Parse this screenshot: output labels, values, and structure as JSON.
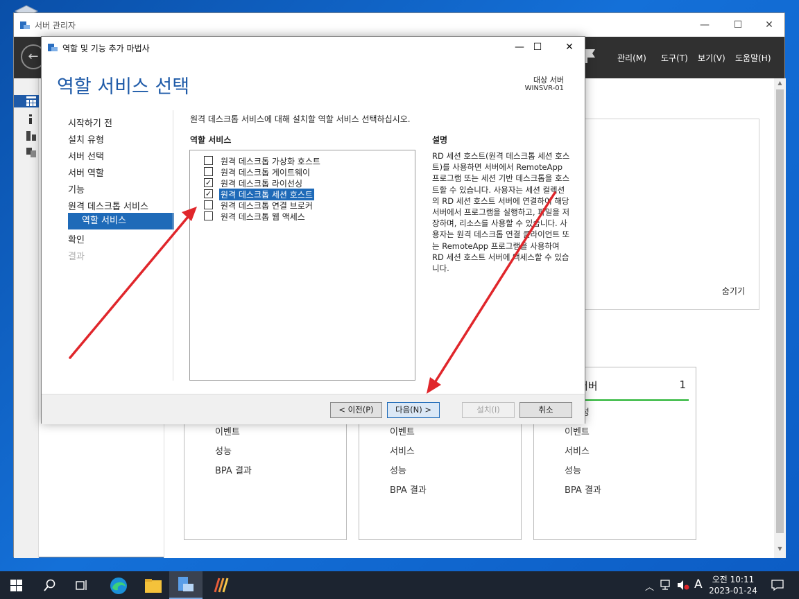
{
  "server_manager": {
    "title": "서버 관리자",
    "menu": [
      "관리(M)",
      "도구(T)",
      "보기(V)",
      "도움말(H)"
    ],
    "welcome_hide": "숨기기",
    "tiles": [
      {
        "header": "",
        "count": "",
        "rows": [
          "이벤트",
          "성능",
          "BPA 결과"
        ]
      },
      {
        "header": "",
        "count": "",
        "rows": [
          "이벤트",
          "서비스",
          "성능",
          "BPA 결과"
        ]
      },
      {
        "header": "서버",
        "count": "1",
        "rows": [
          "효율성",
          "이벤트",
          "서비스",
          "성능",
          "BPA 결과"
        ]
      }
    ]
  },
  "wizard": {
    "title": "역할 및 기능 추가 마법사",
    "page_title": "역할 서비스 선택",
    "destination_label": "대상 서버",
    "destination_server": "WINSVR-01",
    "nav": [
      {
        "label": "시작하기 전",
        "state": "normal"
      },
      {
        "label": "설치 유형",
        "state": "normal"
      },
      {
        "label": "서버 선택",
        "state": "normal"
      },
      {
        "label": "서버 역할",
        "state": "normal"
      },
      {
        "label": "기능",
        "state": "normal"
      },
      {
        "label": "원격 데스크톱 서비스",
        "state": "normal"
      },
      {
        "label": "역할 서비스",
        "state": "selected"
      },
      {
        "label": "확인",
        "state": "normal"
      },
      {
        "label": "결과",
        "state": "disabled"
      }
    ],
    "instruction": "원격 데스크톱 서비스에 대해 설치할 역할 서비스 선택하십시오.",
    "services_heading": "역할 서비스",
    "description_heading": "설명",
    "services": [
      {
        "label": "원격 데스크톱 가상화 호스트",
        "checked": false,
        "highlighted": false
      },
      {
        "label": "원격 데스크톱 게이트웨이",
        "checked": false,
        "highlighted": false
      },
      {
        "label": "원격 데스크톱 라이선싱",
        "checked": true,
        "highlighted": false
      },
      {
        "label": "원격 데스크톱 세션 호스트",
        "checked": true,
        "highlighted": true
      },
      {
        "label": "원격 데스크톱 연결 브로커",
        "checked": false,
        "highlighted": false
      },
      {
        "label": "원격 데스크톱 웹 액세스",
        "checked": false,
        "highlighted": false
      }
    ],
    "description": "RD 세션 호스트(원격 데스크톱 세션 호스트)를 사용하면 서버에서 RemoteApp 프로그램 또는 세션 기반 데스크톱을 호스트할 수 있습니다. 사용자는 세션 컬렉션의 RD 세션 호스트 서버에 연결하여 해당 서버에서 프로그램을 실행하고, 파일을 저장하며, 리소스를 사용할 수 있습니다. 사용자는 원격 데스크톱 연결 클라이언트 또는 RemoteApp 프로그램을 사용하여 RD 세션 호스트 서버에 액세스할 수 있습니다.",
    "buttons": {
      "previous": "< 이전(P)",
      "next": "다음(N) >",
      "install": "설치(I)",
      "cancel": "취소"
    }
  },
  "taskbar": {
    "ime": "A",
    "time": "오전 10:11",
    "date": "2023-01-24"
  },
  "colors": {
    "accent": "#1e6ab8",
    "title_blue": "#1e5aa8",
    "arrow_red": "#e0262b",
    "tile_green": "#22b22e"
  }
}
